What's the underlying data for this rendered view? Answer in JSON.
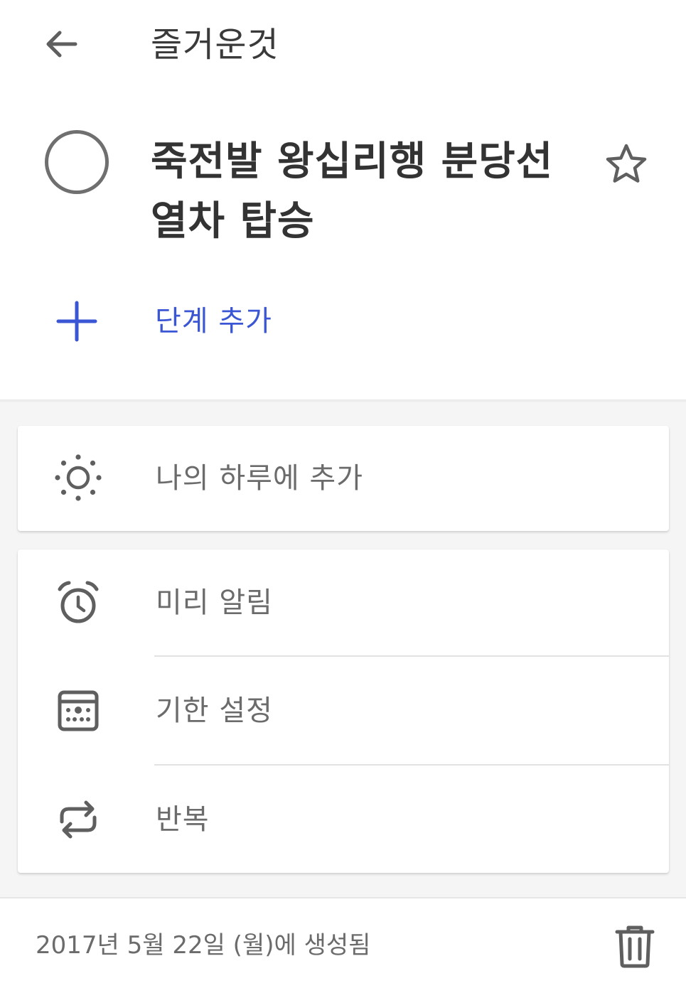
{
  "header": {
    "back_icon": "arrow-back-icon",
    "list_title": "즐거운것"
  },
  "task": {
    "check_icon": "circle-icon",
    "title": "죽전발 왕십리행 분당선 열차 탑승",
    "star_icon": "star-outline-icon"
  },
  "add_step": {
    "icon": "plus-icon",
    "label": "단계 추가",
    "color": "#3a56d4"
  },
  "my_day": {
    "icon": "sun-icon",
    "label": "나의 하루에 추가"
  },
  "options": {
    "reminder": {
      "icon": "alarm-clock-icon",
      "label": "미리 알림"
    },
    "due_date": {
      "icon": "calendar-icon",
      "label": "기한 설정"
    },
    "repeat": {
      "icon": "repeat-icon",
      "label": "반복"
    }
  },
  "footer": {
    "created_text": "2017년 5월 22일 (월)에 생성됨",
    "trash_icon": "trash-icon"
  }
}
